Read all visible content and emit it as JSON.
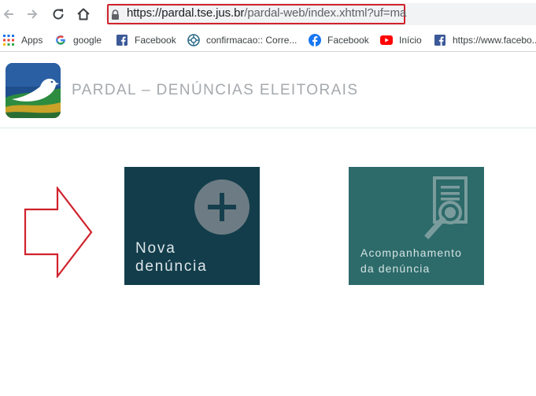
{
  "browser": {
    "url_host": "https://pardal.tse.jus.br",
    "url_path": "/pardal-web/index.xhtml?uf=ma"
  },
  "bookmarks": [
    {
      "label": "Apps",
      "icon": "apps-grid-icon"
    },
    {
      "label": "google",
      "icon": "google-icon"
    },
    {
      "label": "Facebook",
      "icon": "facebook-square-icon"
    },
    {
      "label": "confirmacao:: Corre...",
      "icon": "globe-icon"
    },
    {
      "label": "Facebook",
      "icon": "facebook-round-icon"
    },
    {
      "label": "Início",
      "icon": "youtube-icon"
    },
    {
      "label": "https://www.facebo...",
      "icon": "facebook-square-icon"
    }
  ],
  "site": {
    "title": "PARDAL – DENÚNCIAS ELEITORAIS"
  },
  "tiles": {
    "new_line1": "Nova",
    "new_line2": "denúncia",
    "track_line1": "Acompanhamento",
    "track_line2": "da denúncia"
  },
  "colors": {
    "tile_new": "#133d4b",
    "tile_track": "#2d6a6a",
    "highlight": "#d0222c",
    "title": "#a5a9ad"
  }
}
